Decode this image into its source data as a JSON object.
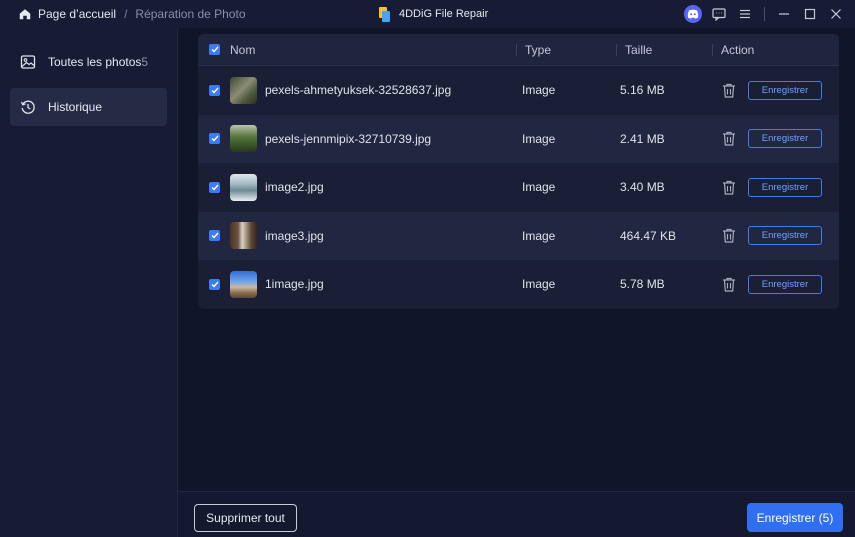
{
  "titlebar": {
    "breadcrumb_home": "Page d’accueil",
    "breadcrumb_separator": "/",
    "breadcrumb_current": "Réparation de Photo",
    "app_title": "4DDiG File Repair",
    "icons": [
      "home-icon",
      "app-logo-icon",
      "discord-icon",
      "feedback-icon",
      "menu-icon",
      "minimize-icon",
      "maximize-icon",
      "close-icon"
    ]
  },
  "sidebar": {
    "items": [
      {
        "label": "Toutes les photos",
        "count": "5",
        "icon": "image-icon",
        "active": false
      },
      {
        "label": "Historique",
        "count": "",
        "icon": "history-icon",
        "active": true
      }
    ]
  },
  "table": {
    "columns": {
      "name": "Nom",
      "type": "Type",
      "size": "Taille",
      "action": "Action"
    },
    "rows": [
      {
        "name": "pexels-ahmetyuksek-32528637.jpg",
        "type": "Image",
        "size": "5.16 MB",
        "action": "Enregistrer",
        "checked": true
      },
      {
        "name": "pexels-jennmipix-32710739.jpg",
        "type": "Image",
        "size": "2.41 MB",
        "action": "Enregistrer",
        "checked": true
      },
      {
        "name": "image2.jpg",
        "type": "Image",
        "size": "3.40 MB",
        "action": "Enregistrer",
        "checked": true
      },
      {
        "name": "image3.jpg",
        "type": "Image",
        "size": "464.47 KB",
        "action": "Enregistrer",
        "checked": true
      },
      {
        "name": "1image.jpg",
        "type": "Image",
        "size": "5.78 MB",
        "action": "Enregistrer",
        "checked": true
      }
    ]
  },
  "footer": {
    "delete_all": "Supprimer tout",
    "save_all": "Enregistrer (5)"
  },
  "colors": {
    "accent": "#2f6ff2",
    "checkbox": "#3b7bf6",
    "background": "#11152a",
    "sidebar": "#171b33"
  }
}
